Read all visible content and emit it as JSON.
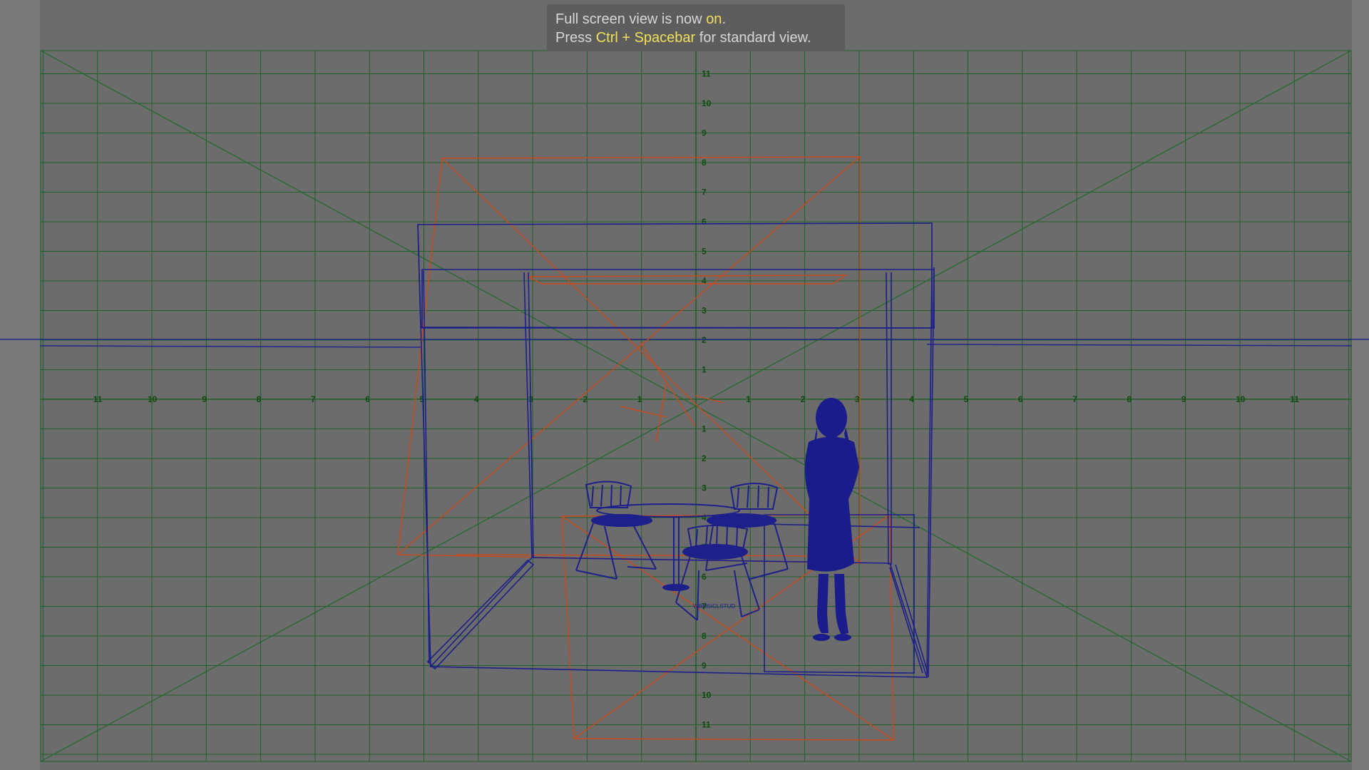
{
  "app": "3D viewport (front orthographic, full screen)",
  "hud": {
    "line1_prefix": "Full screen view is now ",
    "line1_state": "on",
    "line1_suffix": ".",
    "line2_prefix": "Press ",
    "line2_keys": "Ctrl + Spacebar",
    "line2_suffix": " for standard view."
  },
  "grid": {
    "horizontal_ticks": [
      "11",
      "10",
      "9",
      "8",
      "7",
      "6",
      "5",
      "4",
      "3",
      "2",
      "1",
      "",
      "1",
      "2",
      "3",
      "4",
      "5",
      "6",
      "7",
      "8",
      "9",
      "10",
      "11"
    ],
    "vertical_ticks": [
      "11",
      "10",
      "9",
      "8",
      "7",
      "6",
      "5",
      "4",
      "3",
      "2",
      "1",
      "",
      "1",
      "2",
      "3",
      "4",
      "5",
      "6",
      "7",
      "8",
      "9",
      "10",
      "11"
    ]
  },
  "colors": {
    "viewport_bg": "#6c6c6c",
    "grid_line": "#1f5f2a",
    "grid_tick_label": "#0f4a0f",
    "wireframe": "#1d1f8a",
    "camera_frustum": "#c94a1c",
    "hud_highlight": "#f0e05a"
  },
  "scene_objects": [
    "room-wireframe",
    "cafe-table",
    "chair-left",
    "chair-right",
    "chair-front",
    "woman-silhouette",
    "camera-frustum"
  ],
  "chair_label": "WBMSICLSTUD"
}
